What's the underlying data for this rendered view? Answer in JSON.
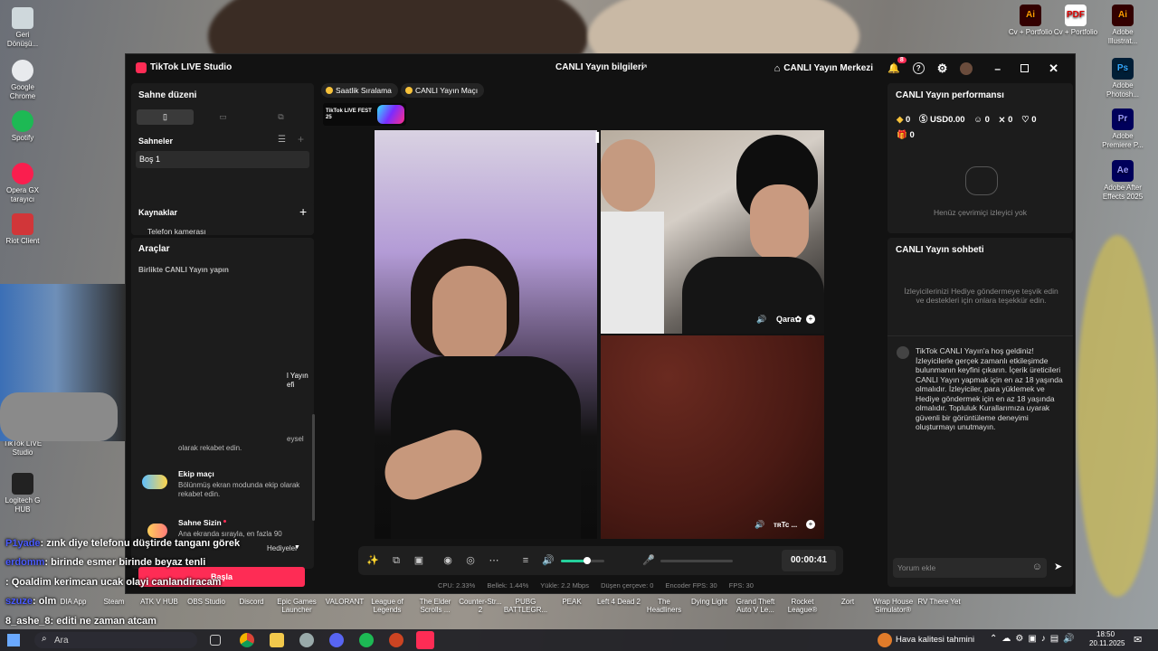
{
  "desktop_left": [
    {
      "label": "Geri Dönüşü...",
      "icon": "recycle-bin-icon"
    },
    {
      "label": "Google Chrome",
      "icon": "chrome-icon"
    },
    {
      "label": "Spotify",
      "icon": "spotify-icon"
    },
    {
      "label": "Opera GX tarayıcı",
      "icon": "opera-gx-icon"
    },
    {
      "label": "Riot Client",
      "icon": "riot-icon"
    },
    {
      "label": "TikTok LIVE Studio",
      "icon": "tiktok-live-icon"
    },
    {
      "label": "Logitech G HUB",
      "icon": "logitech-icon"
    }
  ],
  "desktop_right": [
    {
      "label": "Cv + Portfolio",
      "icon": "illustrator-file-icon"
    },
    {
      "label": "Cv + Portfolio",
      "icon": "pdf-file-icon"
    },
    {
      "label": "Adobe Illustrat...",
      "icon": "illustrator-icon"
    },
    {
      "label": "Adobe Photosh...",
      "icon": "photoshop-icon"
    },
    {
      "label": "Adobe Premiere P...",
      "icon": "premiere-icon"
    },
    {
      "label": "Adobe After Effects 2025",
      "icon": "after-effects-icon"
    }
  ],
  "window": {
    "app_title": "TikTok LIVE Studio",
    "center_title": "CANLI Yayın bilgileri",
    "live_center": "CANLI Yayın Merkezi",
    "notif_count": "8"
  },
  "left": {
    "scene_layout": "Sahne düzeni",
    "scenes": "Sahneler",
    "scene_item": "Boş 1",
    "sources": "Kaynaklar",
    "source_item": "Telefon kamerası",
    "tools": "Araçlar",
    "together": "Birlikte CANLI Yayın yapın",
    "partial_right": "l Yayın",
    "partial_right2": "efi",
    "partial_desc": "eysel",
    "partial_desc2": "olarak rekabet edin.",
    "team_match_title": "Ekip maçı",
    "team_match_desc": "Bölünmüş ekran modunda ekip olarak rekabet edin.",
    "ask_title": "Sahne Sizin",
    "ask_desc": "Ana ekranda sırayla, en fazla 90",
    "gift_text": "Hediyeler",
    "start_button": "Başla"
  },
  "top_chips": {
    "hourly_rank": "Saatlik Sıralama",
    "live_match": "CANLI Yayın Maçı",
    "live_fest": "TikTok LIVE FEST 25"
  },
  "video": {
    "guest1": "Qara✿",
    "guest2": "ᴛʀTc ..."
  },
  "controls": {
    "timer": "00:00:41",
    "volume": 0.6
  },
  "stats": {
    "cpu": "CPU: 2.33%",
    "memory": "Bellek: 1.44%",
    "upload": "Yükle: 2.2 Mbps",
    "dropped": "Düşen çerçeve: 0",
    "encoder": "Encoder FPS: 30",
    "fps": "FPS: 30"
  },
  "right": {
    "perf_title": "CANLI Yayın performansı",
    "diamonds": "0",
    "usd": "USD0.00",
    "viewers": "0",
    "shares": "0",
    "likes": "0",
    "gifts": "0",
    "no_viewers": "Henüz çevrimiçi izleyici yok",
    "chat_title": "CANLI Yayın sohbeti",
    "chat_hint": "İzleyicilerinizi Hediye göndermeye teşvik edin ve destekleri için onlara teşekkür edin.",
    "welcome": "TikTok CANLI Yayın'a hoş geldiniz! İzleyicilerle gerçek zamanlı etkileşimde bulunmanın keyfini çıkarın. İçerik üreticileri CANLI Yayın yapmak için en az 18 yaşında olmalıdır. İzleyiciler, para yüklemek ve Hediye göndermek için en az 18 yaşında olmalıdır. Topluluk Kurallarımıza uyarak güvenli bir görüntüleme deneyimi oluşturmayı unutmayın.",
    "comment_placeholder": "Yorum ekle"
  },
  "overlay_chat": [
    {
      "user": "P1yade",
      "text": ": zınk diye telefonu düştirde tanganı görek"
    },
    {
      "user": "erdomm",
      "text": ": birinde esmer birinde beyaz tenli"
    },
    {
      "user": "",
      "text": ": Qoaldim kerimcan ucak olayi canlandiracam"
    },
    {
      "user": "szuze",
      "text": ": olm"
    },
    {
      "user": "8_ashe_8",
      "text": ": editi ne zaman atcam"
    }
  ],
  "taskbar_labels": [
    "DIA App",
    "Steam",
    "ATK V HUB",
    "OBS Studio",
    "Discord",
    "Epic Games Launcher",
    "VALORANT",
    "League of Legends",
    "The Elder Scrolls ...",
    "Counter-Str... 2",
    "PUBG BATTLEGR...",
    "PEAK",
    "Left 4 Dead 2",
    "The Headliners",
    "Dying Light",
    "Grand Theft Auto V Le...",
    "Rocket League®",
    "Zort",
    "Wrap House Simulator®",
    "RV There Yet"
  ],
  "taskbar": {
    "search": "Ara",
    "weather": "Hava kalitesi tahmini",
    "time": "18:50",
    "date": "20.11.2025"
  }
}
